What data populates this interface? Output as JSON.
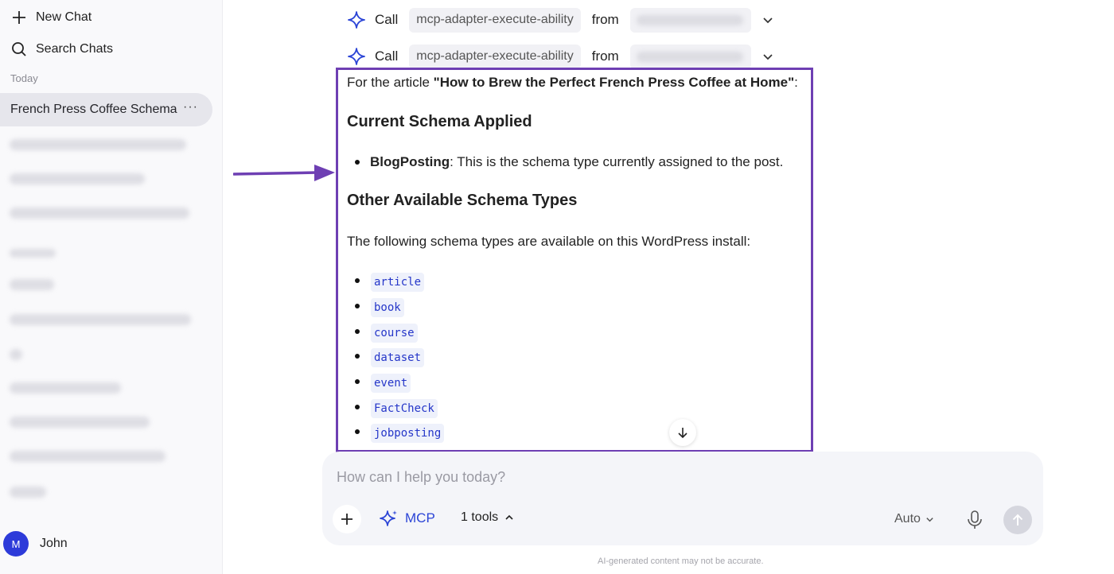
{
  "sidebar": {
    "new_chat": "New Chat",
    "search_chats": "Search Chats",
    "section_today": "Today",
    "active_chat": "French Press Coffee Schema",
    "more_label": "···",
    "user": {
      "initial": "M",
      "name": "John",
      "avatar_color": "#2d3bd9"
    }
  },
  "tool_calls": [
    {
      "call_label": "Call",
      "tool": "mcp-adapter-execute-ability",
      "from_label": "from"
    },
    {
      "call_label": "Call",
      "tool": "mcp-adapter-execute-ability",
      "from_label": "from"
    }
  ],
  "message": {
    "intro_prefix": "For the article ",
    "article_title": "\"How to Brew the Perfect French Press Coffee at Home\"",
    "intro_suffix": ":",
    "heading_current": "Current Schema Applied",
    "current_item_bold": "BlogPosting",
    "current_item_rest": ": This is the schema type currently assigned to the post.",
    "heading_other": "Other Available Schema Types",
    "other_intro": "The following schema types are available on this WordPress install:",
    "schema_types": [
      "article",
      "book",
      "course",
      "dataset",
      "event",
      "FactCheck",
      "jobposting"
    ]
  },
  "composer": {
    "placeholder": "How can I help you today?",
    "mcp_label": "MCP",
    "tools_label": "1 tools",
    "model_label": "Auto",
    "disclaimer": "AI-generated content may not be accurate."
  },
  "colors": {
    "highlight_border": "#6e3fb3",
    "accent_blue": "#2b44d6",
    "code_text": "#2536c9"
  }
}
